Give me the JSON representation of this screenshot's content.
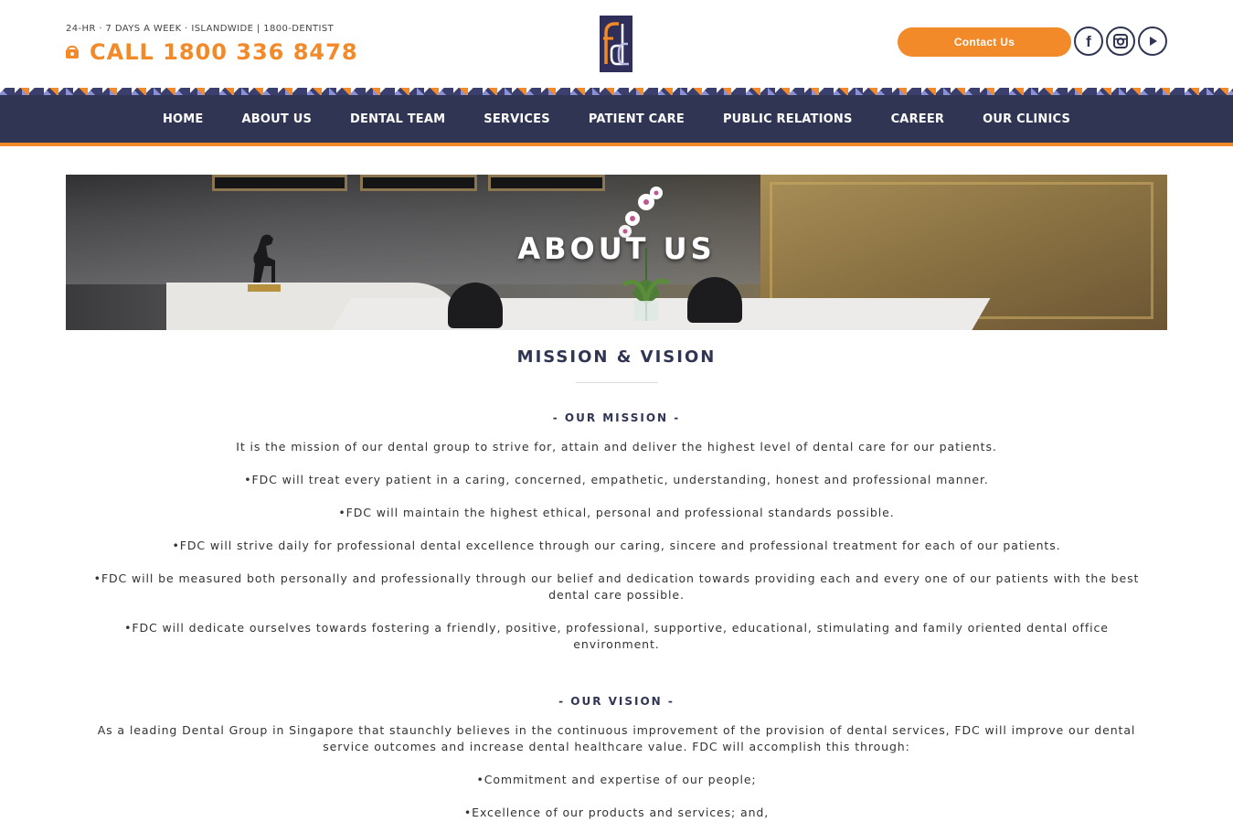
{
  "header": {
    "tagline": "24-HR · 7 DAYS A WEEK · ISLANDWIDE | 1800-DENTIST",
    "call_text": "CALL 1800 336 8478",
    "logo_text": "fdc",
    "contact_label": "Contact Us",
    "social": [
      "facebook-icon",
      "instagram-icon",
      "youtube-icon"
    ]
  },
  "nav": {
    "items": [
      "HOME",
      "ABOUT US",
      "DENTAL TEAM",
      "SERVICES",
      "PATIENT CARE",
      "PUBLIC RELATIONS",
      "CAREER",
      "OUR CLINICS"
    ]
  },
  "banner": {
    "title": "ABOUT US"
  },
  "content": {
    "section_title": "MISSION & VISION",
    "mission_heading": "- OUR MISSION -",
    "mission_paragraphs": [
      "It is the mission of our dental group to strive for, attain and deliver the highest level of dental care for our patients.",
      "•FDC will treat every patient in a caring, concerned, empathetic, understanding, honest and professional manner.",
      "•FDC will maintain the highest ethical, personal and professional standards possible.",
      "•FDC will strive daily for professional dental excellence through our caring, sincere and professional treatment for each of our patients.",
      "•FDC will be measured both personally and professionally through our belief and dedication towards providing each and every one of our patients with the best dental care possible.",
      "•FDC will dedicate ourselves towards fostering a friendly, positive, professional, supportive, educational, stimulating and family oriented dental office environment."
    ],
    "vision_heading": "- OUR VISION -",
    "vision_paragraphs": [
      "As a leading Dental Group in Singapore that staunchly believes in the continuous improvement of the provision of dental services, FDC will improve our dental service outcomes and increase dental healthcare value. FDC will accomplish this through:",
      "•Commitment and expertise of our people;",
      "•Excellence of our products and services; and,"
    ]
  },
  "colors": {
    "brand_navy": "#2f3553",
    "brand_orange": "#f28a2a"
  }
}
